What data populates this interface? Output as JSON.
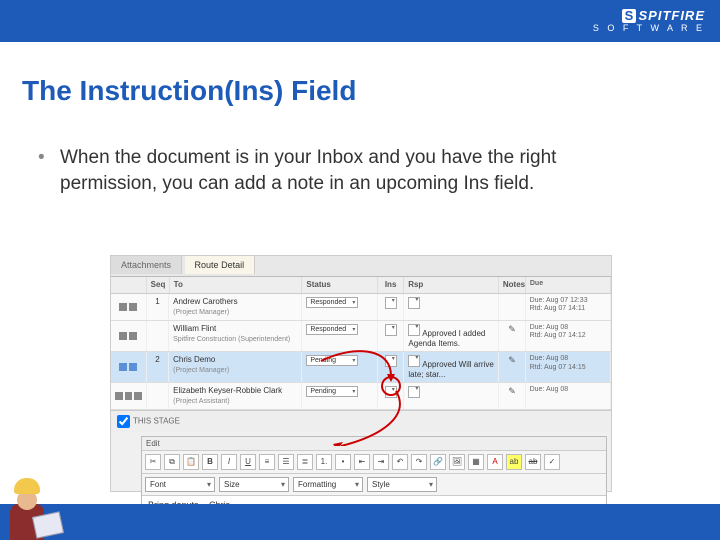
{
  "brand": {
    "name": "SPITFIRE",
    "sub": "S O F T W A R E"
  },
  "title": "The Instruction(Ins) Field",
  "bullet": "When the document is in your Inbox and you have the right permission, you can add a note in an upcoming Ins field.",
  "tabs": {
    "attachments": "Attachments",
    "route": "Route Detail"
  },
  "headers": {
    "seq": "Seq",
    "to": "To",
    "status": "Status",
    "ins": "Ins",
    "rsp": "Rsp",
    "notes": "Notes",
    "due": "Due"
  },
  "rows": [
    {
      "seq": "1",
      "to": "Andrew Carothers",
      "role": "(Project Manager)",
      "status": "Responded",
      "rsp": "",
      "due1": "Due: Aug 07 12:33",
      "due2": "Rtd: Aug 07 14:11"
    },
    {
      "seq": "",
      "to": "William Flint",
      "role": "Spitfire Construction (Superintendent)",
      "status": "Responded",
      "rsp": "Approved\nI added Agenda Items.",
      "due1": "Due: Aug 08",
      "due2": "Rtd: Aug 07 14:12"
    },
    {
      "seq": "2",
      "to": "Chris Demo",
      "role": "(Project Manager)",
      "status": "Pending",
      "rsp": "Approved\nWill arrive late; star...",
      "due1": "Due: Aug 08",
      "due2": "Rtd: Aug 07 14:15"
    },
    {
      "seq": "",
      "to": "Elizabeth Keyser-Robbie Clark",
      "role": "(Project Assistant)",
      "status": "Pending",
      "rsp": "",
      "due1": "Due: Aug 08",
      "due2": ""
    }
  ],
  "stage": "THIS STAGE",
  "editor": {
    "label": "Edit",
    "dropdowns": {
      "font": "Font",
      "size": "Size",
      "format": "Formatting",
      "style": "Style"
    },
    "text": "Bring donuts. - Chris"
  }
}
